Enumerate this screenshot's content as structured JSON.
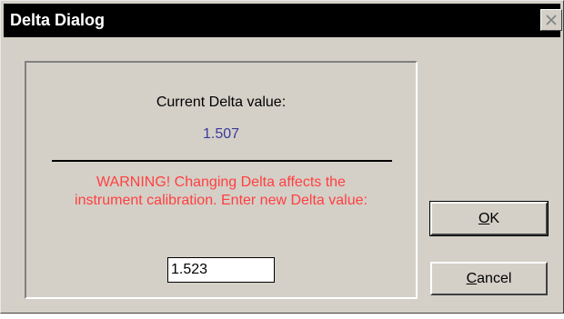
{
  "window": {
    "title": "Delta Dialog",
    "close_icon": "close-icon"
  },
  "panel": {
    "current_label": "Current Delta value:",
    "current_value": "1.507",
    "warning_line1": "WARNING! Changing Delta affects the",
    "warning_line2": "instrument calibration. Enter new Delta value:",
    "new_value": "1.523"
  },
  "buttons": {
    "ok_accel": "O",
    "ok_rest": "K",
    "cancel_accel": "C",
    "cancel_rest": "ancel"
  },
  "colors": {
    "titlebar": "#000000",
    "face": "#d4d0c8",
    "value_text": "#3a3a9a",
    "warning_text": "#ff4040"
  }
}
